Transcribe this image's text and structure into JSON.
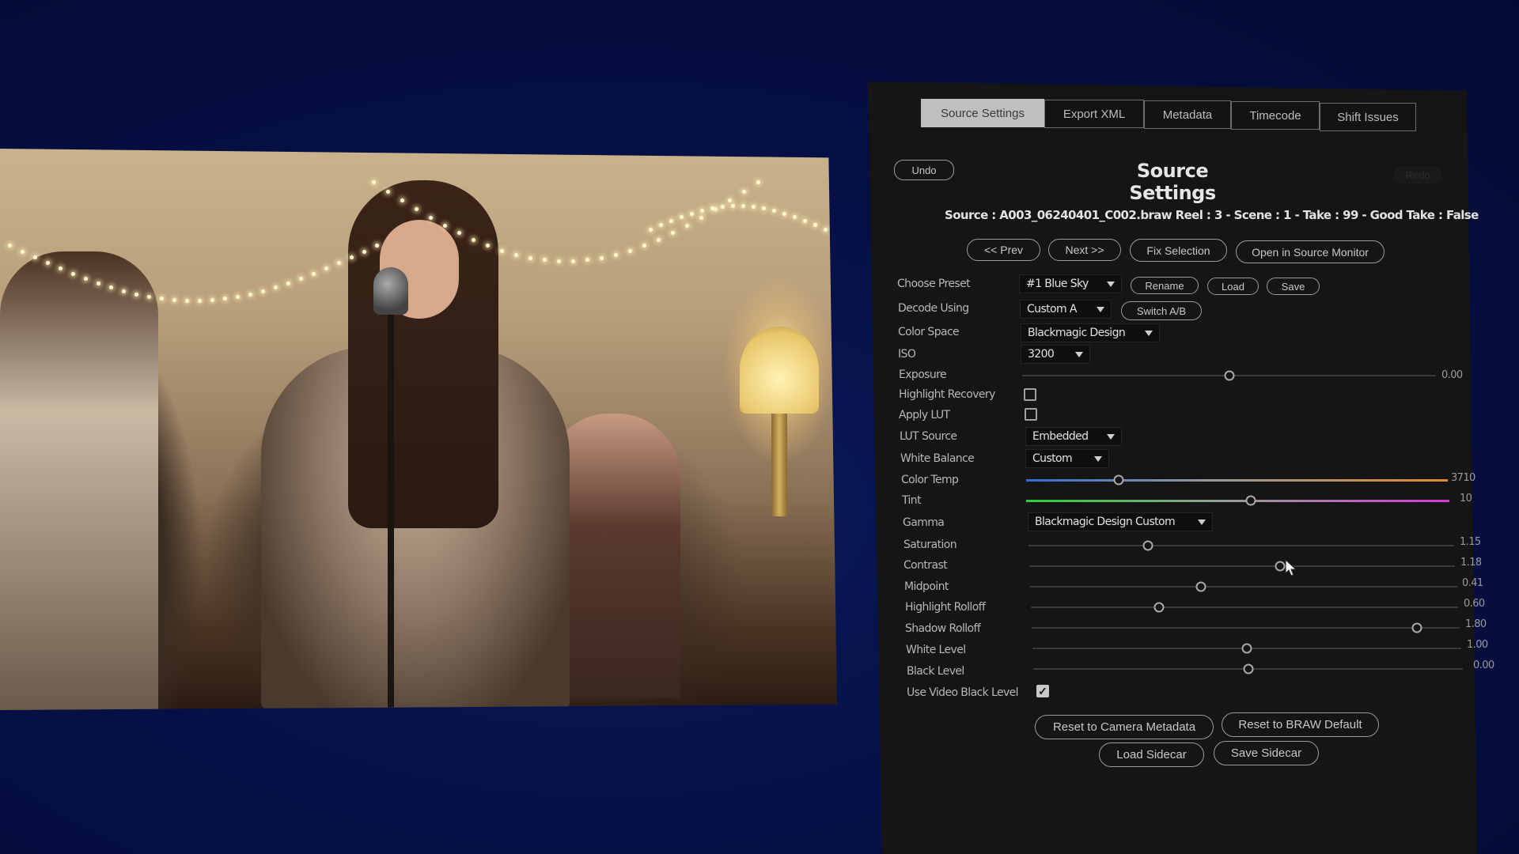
{
  "tabs": [
    {
      "label": "Source Settings",
      "active": true
    },
    {
      "label": "Export XML",
      "active": false
    },
    {
      "label": "Metadata",
      "active": false
    },
    {
      "label": "Timecode",
      "active": false
    },
    {
      "label": "Shift Issues",
      "active": false
    }
  ],
  "header": {
    "undo_label": "Undo",
    "redo_label": "Redo",
    "title": "Source Settings",
    "source_line": "Source : A003_06240401_C002.braw   Reel : 3 - Scene : 1 - Take : 99 - Good Take : False"
  },
  "nav": {
    "prev_label": "<< Prev",
    "next_label": "Next >>",
    "fix_selection_label": "Fix Selection",
    "open_source_monitor_label": "Open in Source Monitor"
  },
  "fields": {
    "choose_preset": {
      "label": "Choose Preset",
      "value": "#1 Blue Sky",
      "rename_label": "Rename",
      "load_label": "Load",
      "save_label": "Save"
    },
    "decode_using": {
      "label": "Decode Using",
      "value": "Custom A",
      "switch_label": "Switch A/B"
    },
    "color_space": {
      "label": "Color Space",
      "value": "Blackmagic Design"
    },
    "iso": {
      "label": "ISO",
      "value": "3200"
    },
    "exposure": {
      "label": "Exposure",
      "value": "0.00",
      "position": 0.5
    },
    "highlight_recovery": {
      "label": "Highlight Recovery",
      "checked": false
    },
    "apply_lut": {
      "label": "Apply LUT",
      "checked": false
    },
    "lut_source": {
      "label": "LUT Source",
      "value": "Embedded"
    },
    "white_balance": {
      "label": "White Balance",
      "value": "Custom"
    },
    "color_temp": {
      "label": "Color Temp",
      "value": "3710",
      "position": 0.22
    },
    "tint": {
      "label": "Tint",
      "value": "10",
      "position": 0.53
    },
    "gamma": {
      "label": "Gamma",
      "value": "Blackmagic Design Custom"
    },
    "saturation": {
      "label": "Saturation",
      "value": "1.15",
      "position": 0.28
    },
    "contrast": {
      "label": "Contrast",
      "value": "1.18",
      "position": 0.59
    },
    "midpoint": {
      "label": "Midpoint",
      "value": "0.41",
      "position": 0.4
    },
    "highlight_rolloff": {
      "label": "Highlight Rolloff",
      "value": "0.60",
      "position": 0.3
    },
    "shadow_rolloff": {
      "label": "Shadow Rolloff",
      "value": "1.80",
      "position": 0.9
    },
    "white_level": {
      "label": "White Level",
      "value": "1.00",
      "position": 0.5
    },
    "black_level": {
      "label": "Black Level",
      "value": "0.00",
      "position": 0.5
    },
    "use_video_black_level": {
      "label": "Use Video Black Level",
      "checked": true
    }
  },
  "footer": {
    "reset_camera_label": "Reset to Camera Metadata",
    "reset_braw_label": "Reset to BRAW Default",
    "load_sidecar_label": "Load Sidecar",
    "save_sidecar_label": "Save Sidecar"
  },
  "colors": {
    "background": "#061046",
    "panel": "#161516",
    "active_tab": "#bfbfbf",
    "temp_cool": "#2f6fd6",
    "temp_warm": "#e68a2a",
    "tint_green": "#2fcf3a",
    "tint_magenta": "#d23bd6"
  },
  "icons": {
    "dropdown": "caret-down-icon",
    "checkmark": "✓",
    "cursor": "mouse-pointer-icon"
  }
}
